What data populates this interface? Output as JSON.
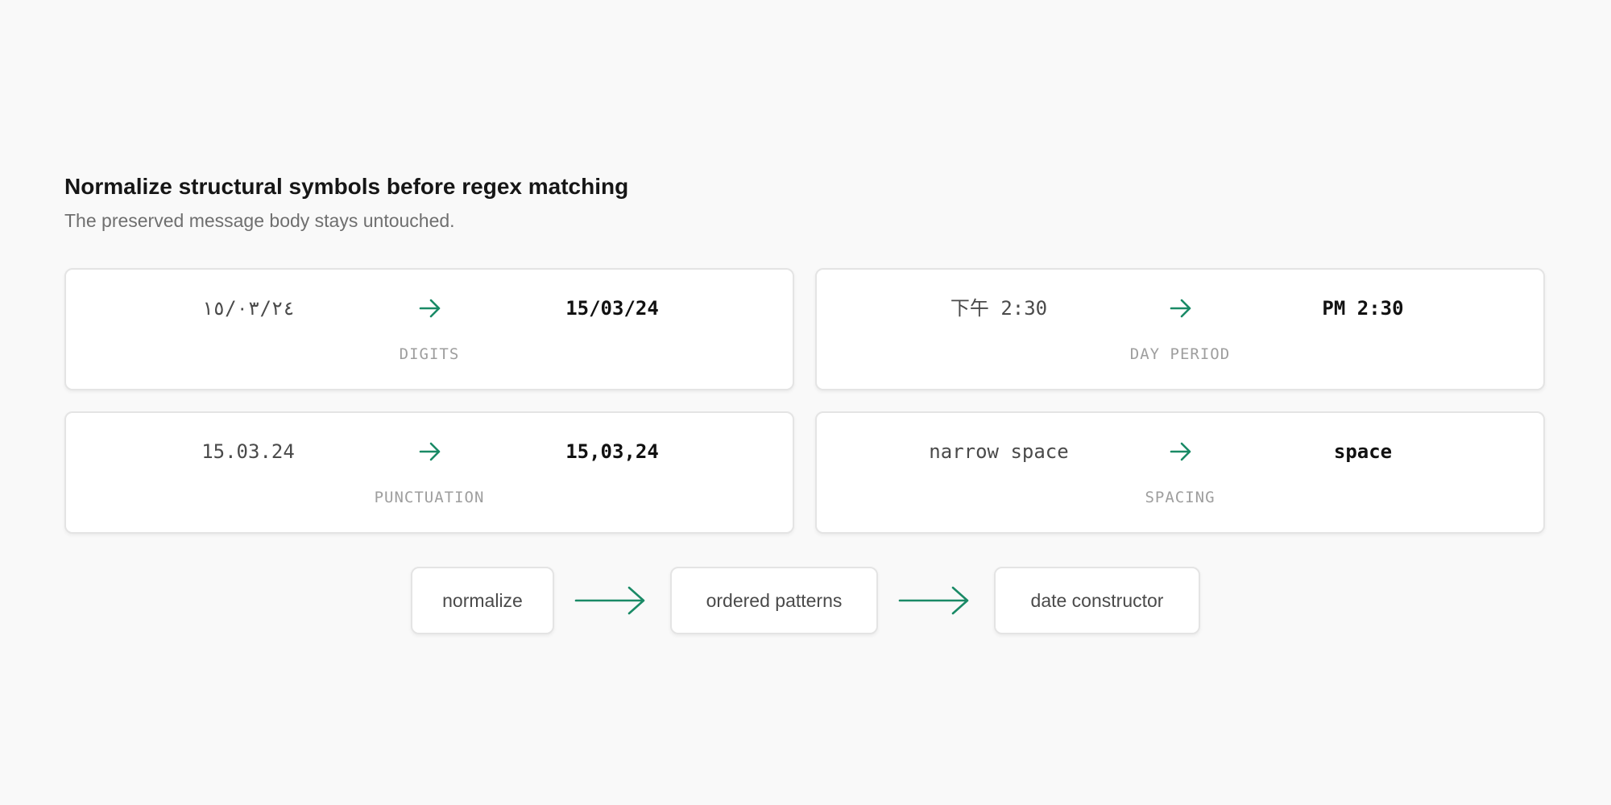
{
  "header": {
    "title": "Normalize structural symbols before regex matching",
    "subtitle": "The preserved message body stays untouched."
  },
  "cards": [
    {
      "from": "١٥/٠٣/٢٤",
      "to": "15/03/24",
      "tag": "DIGITS"
    },
    {
      "from": "下午 2:30",
      "to": "PM 2:30",
      "tag": "DAY PERIOD"
    },
    {
      "from": "15.03.24",
      "to": "15,03,24",
      "tag": "PUNCTUATION"
    },
    {
      "from": "narrow space",
      "to": "space",
      "tag": "SPACING"
    }
  ],
  "pipeline": {
    "steps": [
      "normalize",
      "ordered patterns",
      "date constructor"
    ]
  },
  "colors": {
    "accent": "#1a8a66",
    "card_border": "#e4e4e4",
    "background": "#f9f9f9"
  },
  "icons": {
    "transform": "right-arrow-icon",
    "flow": "long-right-arrow-icon"
  }
}
